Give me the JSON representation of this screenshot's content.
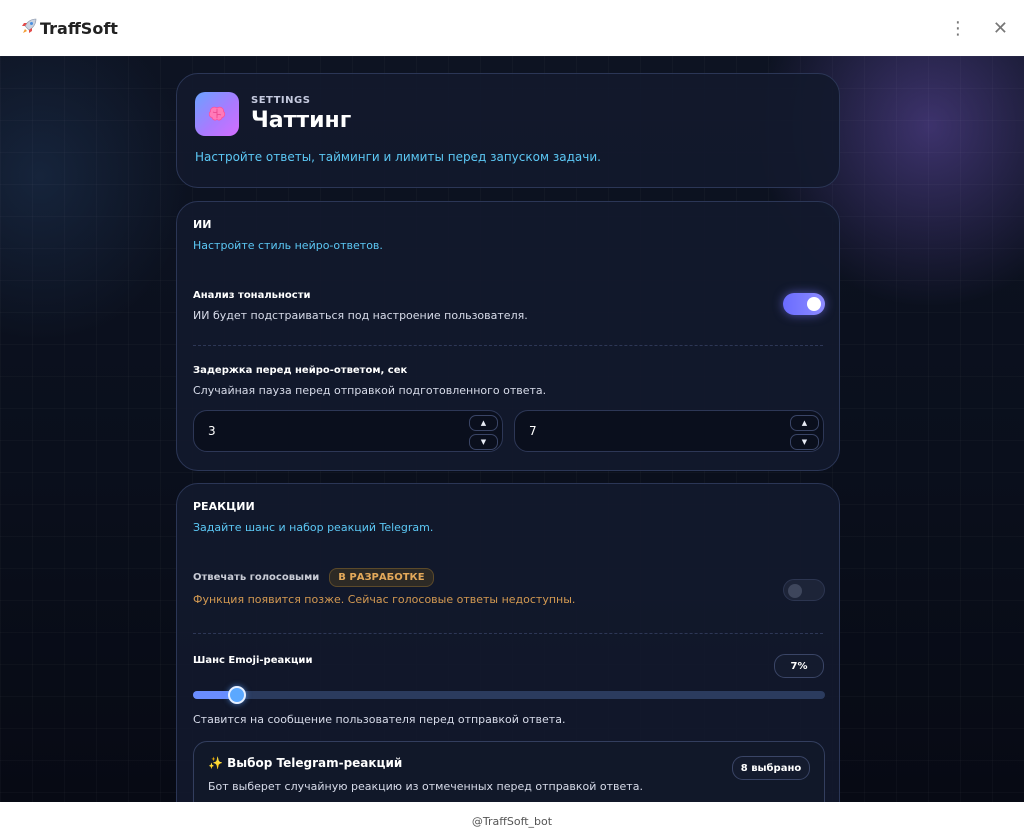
{
  "window": {
    "title": "TraffSoft",
    "title_icon": "rocket-icon"
  },
  "header": {
    "eyebrow": "SETTINGS",
    "title": "Чаттинг",
    "subtitle": "Настройте ответы, тайминги и лимиты перед запуском задачи."
  },
  "ai": {
    "title": "ИИ",
    "subtitle": "Настройте стиль нейро-ответов.",
    "sentiment": {
      "label": "Анализ тональности",
      "description": "ИИ будет подстраиваться под настроение пользователя.",
      "enabled": true
    },
    "delay": {
      "label": "Задержка перед нейро-ответом, сек",
      "description": "Случайная пауза перед отправкой подготовленного ответа.",
      "min": "3",
      "max": "7"
    }
  },
  "reactions": {
    "title": "РЕАКЦИИ",
    "subtitle": "Задайте шанс и набор реакций Telegram.",
    "voice": {
      "label": "Отвечать голосовыми",
      "badge": "В РАЗРАБОТКЕ",
      "description": "Функция появится позже. Сейчас голосовые ответы недоступны.",
      "enabled": false
    },
    "emoji_chance": {
      "label": "Шанс Emoji-реакции",
      "value_text": "7%",
      "value": 7,
      "description": "Ставится на сообщение пользователя перед отправкой ответа."
    },
    "picker": {
      "title": "✨ Выбор Telegram-реакций",
      "count_badge": "8 выбрано",
      "description": "Бот выберет случайную реакцию из отмеченных перед отправкой ответа."
    }
  },
  "footer": {
    "text": "@TraffSoft_bot"
  },
  "colors": {
    "accent": "#6a6cff",
    "link": "#5cc8f5",
    "warning": "#e3a95a"
  }
}
